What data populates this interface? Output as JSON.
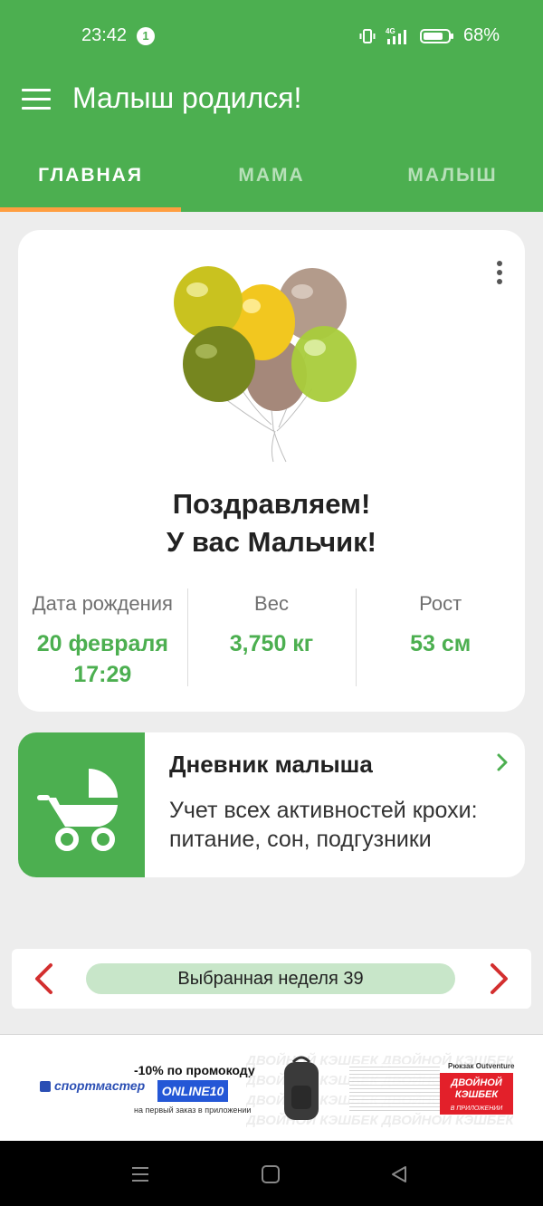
{
  "status_bar": {
    "time": "23:42",
    "notification_count": "1",
    "battery": "68%",
    "network_label": "4G"
  },
  "app_bar": {
    "title": "Малыш родился!"
  },
  "tabs": [
    {
      "label": "ГЛАВНАЯ",
      "active": true
    },
    {
      "label": "МАМА",
      "active": false
    },
    {
      "label": "МАЛЫШ",
      "active": false
    }
  ],
  "baby_card": {
    "congrats_line1": "Поздравляем!",
    "congrats_line2": "У вас Мальчик!",
    "stats": [
      {
        "label": "Дата рождения",
        "value_line1": "20 февраля",
        "value_line2": "17:29"
      },
      {
        "label": "Вес",
        "value_line1": "3,750 кг",
        "value_line2": ""
      },
      {
        "label": "Рост",
        "value_line1": "53 см",
        "value_line2": ""
      }
    ]
  },
  "diary_card": {
    "title": "Дневник малыша",
    "description": "Учет всех активностей крохи: питание, сон, подгузники"
  },
  "week_selector": {
    "label": "Выбранная неделя 39"
  },
  "ad_banner": {
    "brand": "спортмастер",
    "promo_text": "-10% по промокоду",
    "promo_code": "ONLINE10",
    "promo_sub": "на первый заказ в приложении",
    "pattern_text": "ДВОЙНОЙ КЭШБЕК ДВОЙНОЙ КЭШБЕК",
    "product": "Рюкзак Outventure",
    "cashback_line1": "ДВОЙНОЙ",
    "cashback_line2": "КЭШБЕК",
    "cashback_sub": "В ПРИЛОЖЕНИИ"
  },
  "colors": {
    "primary": "#4caf50",
    "tab_indicator": "#ff9e40",
    "accent_red": "#d32f2f",
    "week_pill": "#c8e6c9"
  }
}
